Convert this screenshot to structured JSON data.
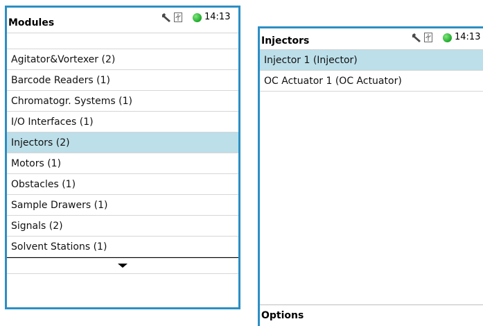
{
  "left_panel": {
    "title": "Modules",
    "time": "14:13",
    "items": [
      {
        "label": "Agitator&Vortexer (2)",
        "selected": false
      },
      {
        "label": "Barcode Readers (1)",
        "selected": false
      },
      {
        "label": "Chromatogr. Systems (1)",
        "selected": false
      },
      {
        "label": "I/O Interfaces (1)",
        "selected": false
      },
      {
        "label": "Injectors (2)",
        "selected": true
      },
      {
        "label": "Motors (1)",
        "selected": false
      },
      {
        "label": "Obstacles (1)",
        "selected": false
      },
      {
        "label": "Sample Drawers (1)",
        "selected": false
      },
      {
        "label": "Signals (2)",
        "selected": false
      },
      {
        "label": "Solvent Stations (1)",
        "selected": false
      }
    ]
  },
  "right_panel": {
    "title": "Injectors",
    "time": "14:13",
    "items": [
      {
        "label": "Injector 1 (Injector)",
        "selected": true
      },
      {
        "label": "OC Actuator 1 (OC Actuator)",
        "selected": false
      }
    ],
    "footer_label": "Options"
  },
  "icons": {
    "status_left": [
      "wrench-icon",
      "usb-icon",
      "status-ok-icon"
    ],
    "status_right": [
      "wrench-icon",
      "usb-icon",
      "status-ok-icon"
    ]
  },
  "colors": {
    "frame_border": "#2b8fc4",
    "selected_row": "#bcdfe9",
    "status_ok": "#1ea82a"
  }
}
